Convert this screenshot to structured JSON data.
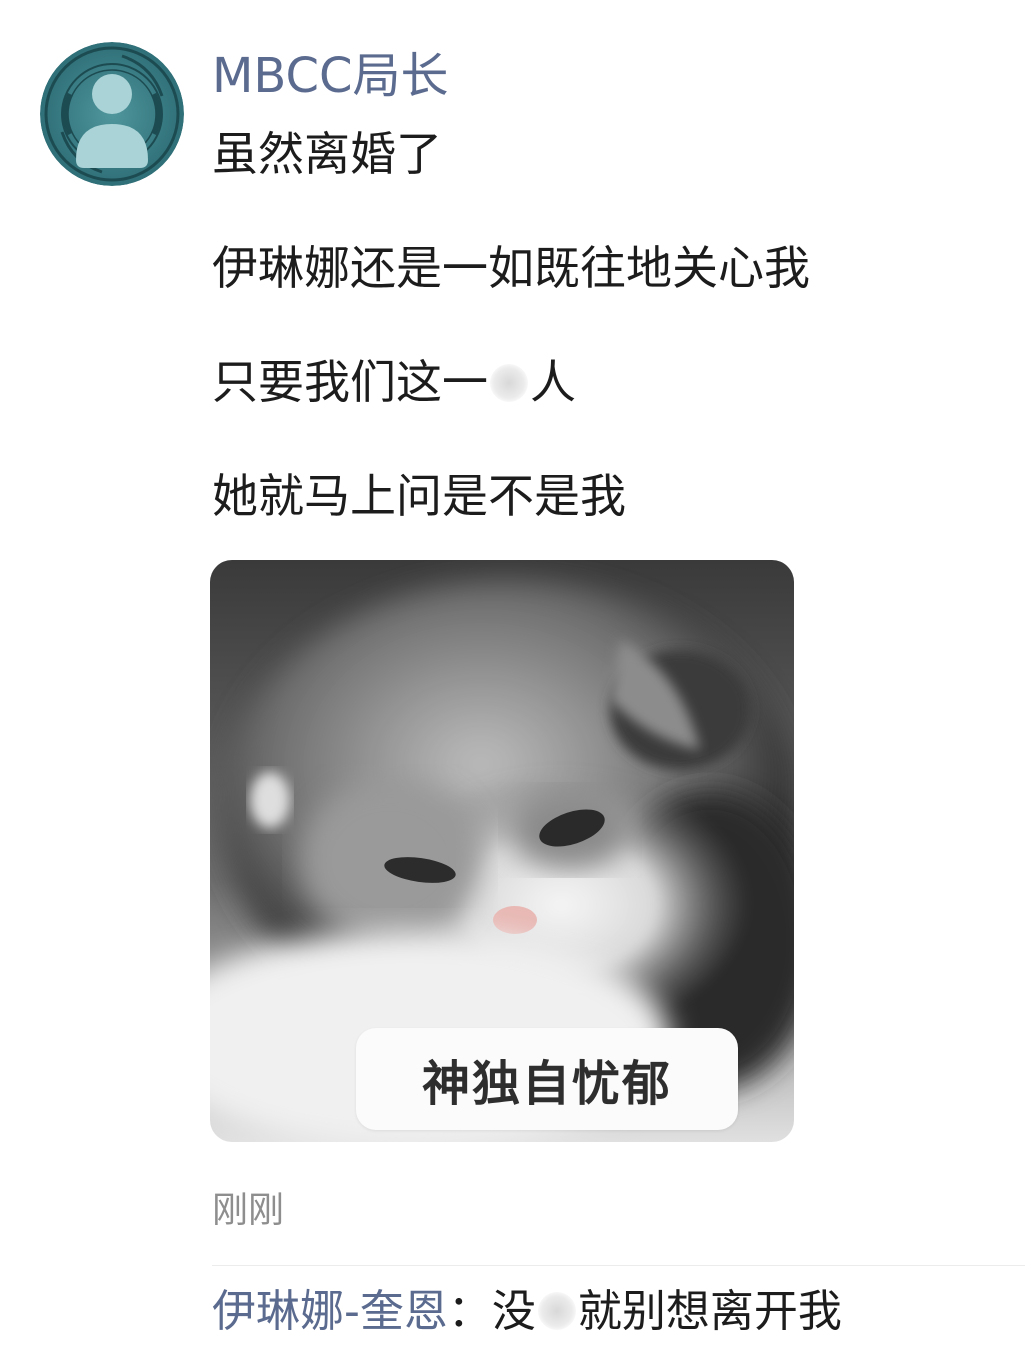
{
  "post": {
    "author": "MBCC局长",
    "lines": [
      "虽然离婚了",
      "伊琳娜还是一如既往地关心我",
      "只要我们这一",
      "人",
      "她就马上问是不是我"
    ],
    "image": {
      "caption": "神独自忧郁",
      "subject": "kitten"
    },
    "timestamp": "刚刚"
  },
  "comment": {
    "author": "伊琳娜-奎恩",
    "separator": "：",
    "text_before_blur": "没",
    "text_after_blur": "就别想离开我"
  },
  "colors": {
    "name_link": "#5b6b8f",
    "body_text": "#1c1c1c",
    "timestamp": "#8e8e8e",
    "avatar_bg": "#3a7f87",
    "avatar_silhouette": "#a9d3d6"
  }
}
